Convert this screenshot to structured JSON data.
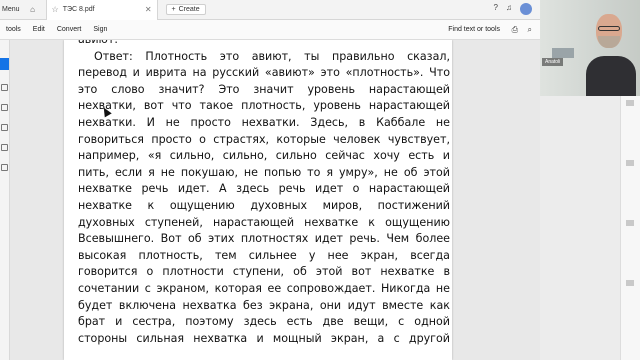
{
  "tabbar": {
    "menu_label": "Menu",
    "tab_title": "ТЭС 8.pdf",
    "create_label": "Create"
  },
  "menubar": {
    "items": [
      "tools",
      "Edit",
      "Convert",
      "Sign"
    ],
    "find_label": "Find text or tools"
  },
  "document": {
    "lines": [
      "авиют.",
      "Ответ: Плотность это авиют, ты правильно сказал,",
      "перевод и иврита на русский «авиют» это «плотность». Что",
      "это слово значит? Это значит уровень нарастающей",
      "нехватки, вот что такое плотность, уровень нарастающей",
      "нехватки. И не просто нехватки. Здесь, в Каббале не",
      "говориться просто о страстях, которые человек чувствует,",
      "например, «я сильно, сильно, сильно сейчас хочу есть и",
      "пить, если я не покушаю, не попью то я умру», не об этой",
      "нехватке речь идет. А здесь речь идет о нарастающей",
      "нехватке к ощущению духовных миров, постижений",
      "духовных ступеней, нарастающей нехватке к ощущению",
      "Всевышнего. Вот об этих плотностях идет речь. Чем более",
      "высокая плотность, тем сильнее у нее экран, всегда",
      "говорится о плотности ступени, об этой вот нехватке в",
      "сочетании с экраном, которая ее сопровождает. Никогда не",
      "будет включена нехватка без экрана, они идут вместе как",
      "брат и сестра, поэтому здесь есть две вещи, с одной",
      "стороны сильная нехватка и мощный экран, а с другой"
    ]
  },
  "webcam": {
    "name_label": "Anatoli"
  },
  "colors": {
    "accent": "#1473e6"
  }
}
